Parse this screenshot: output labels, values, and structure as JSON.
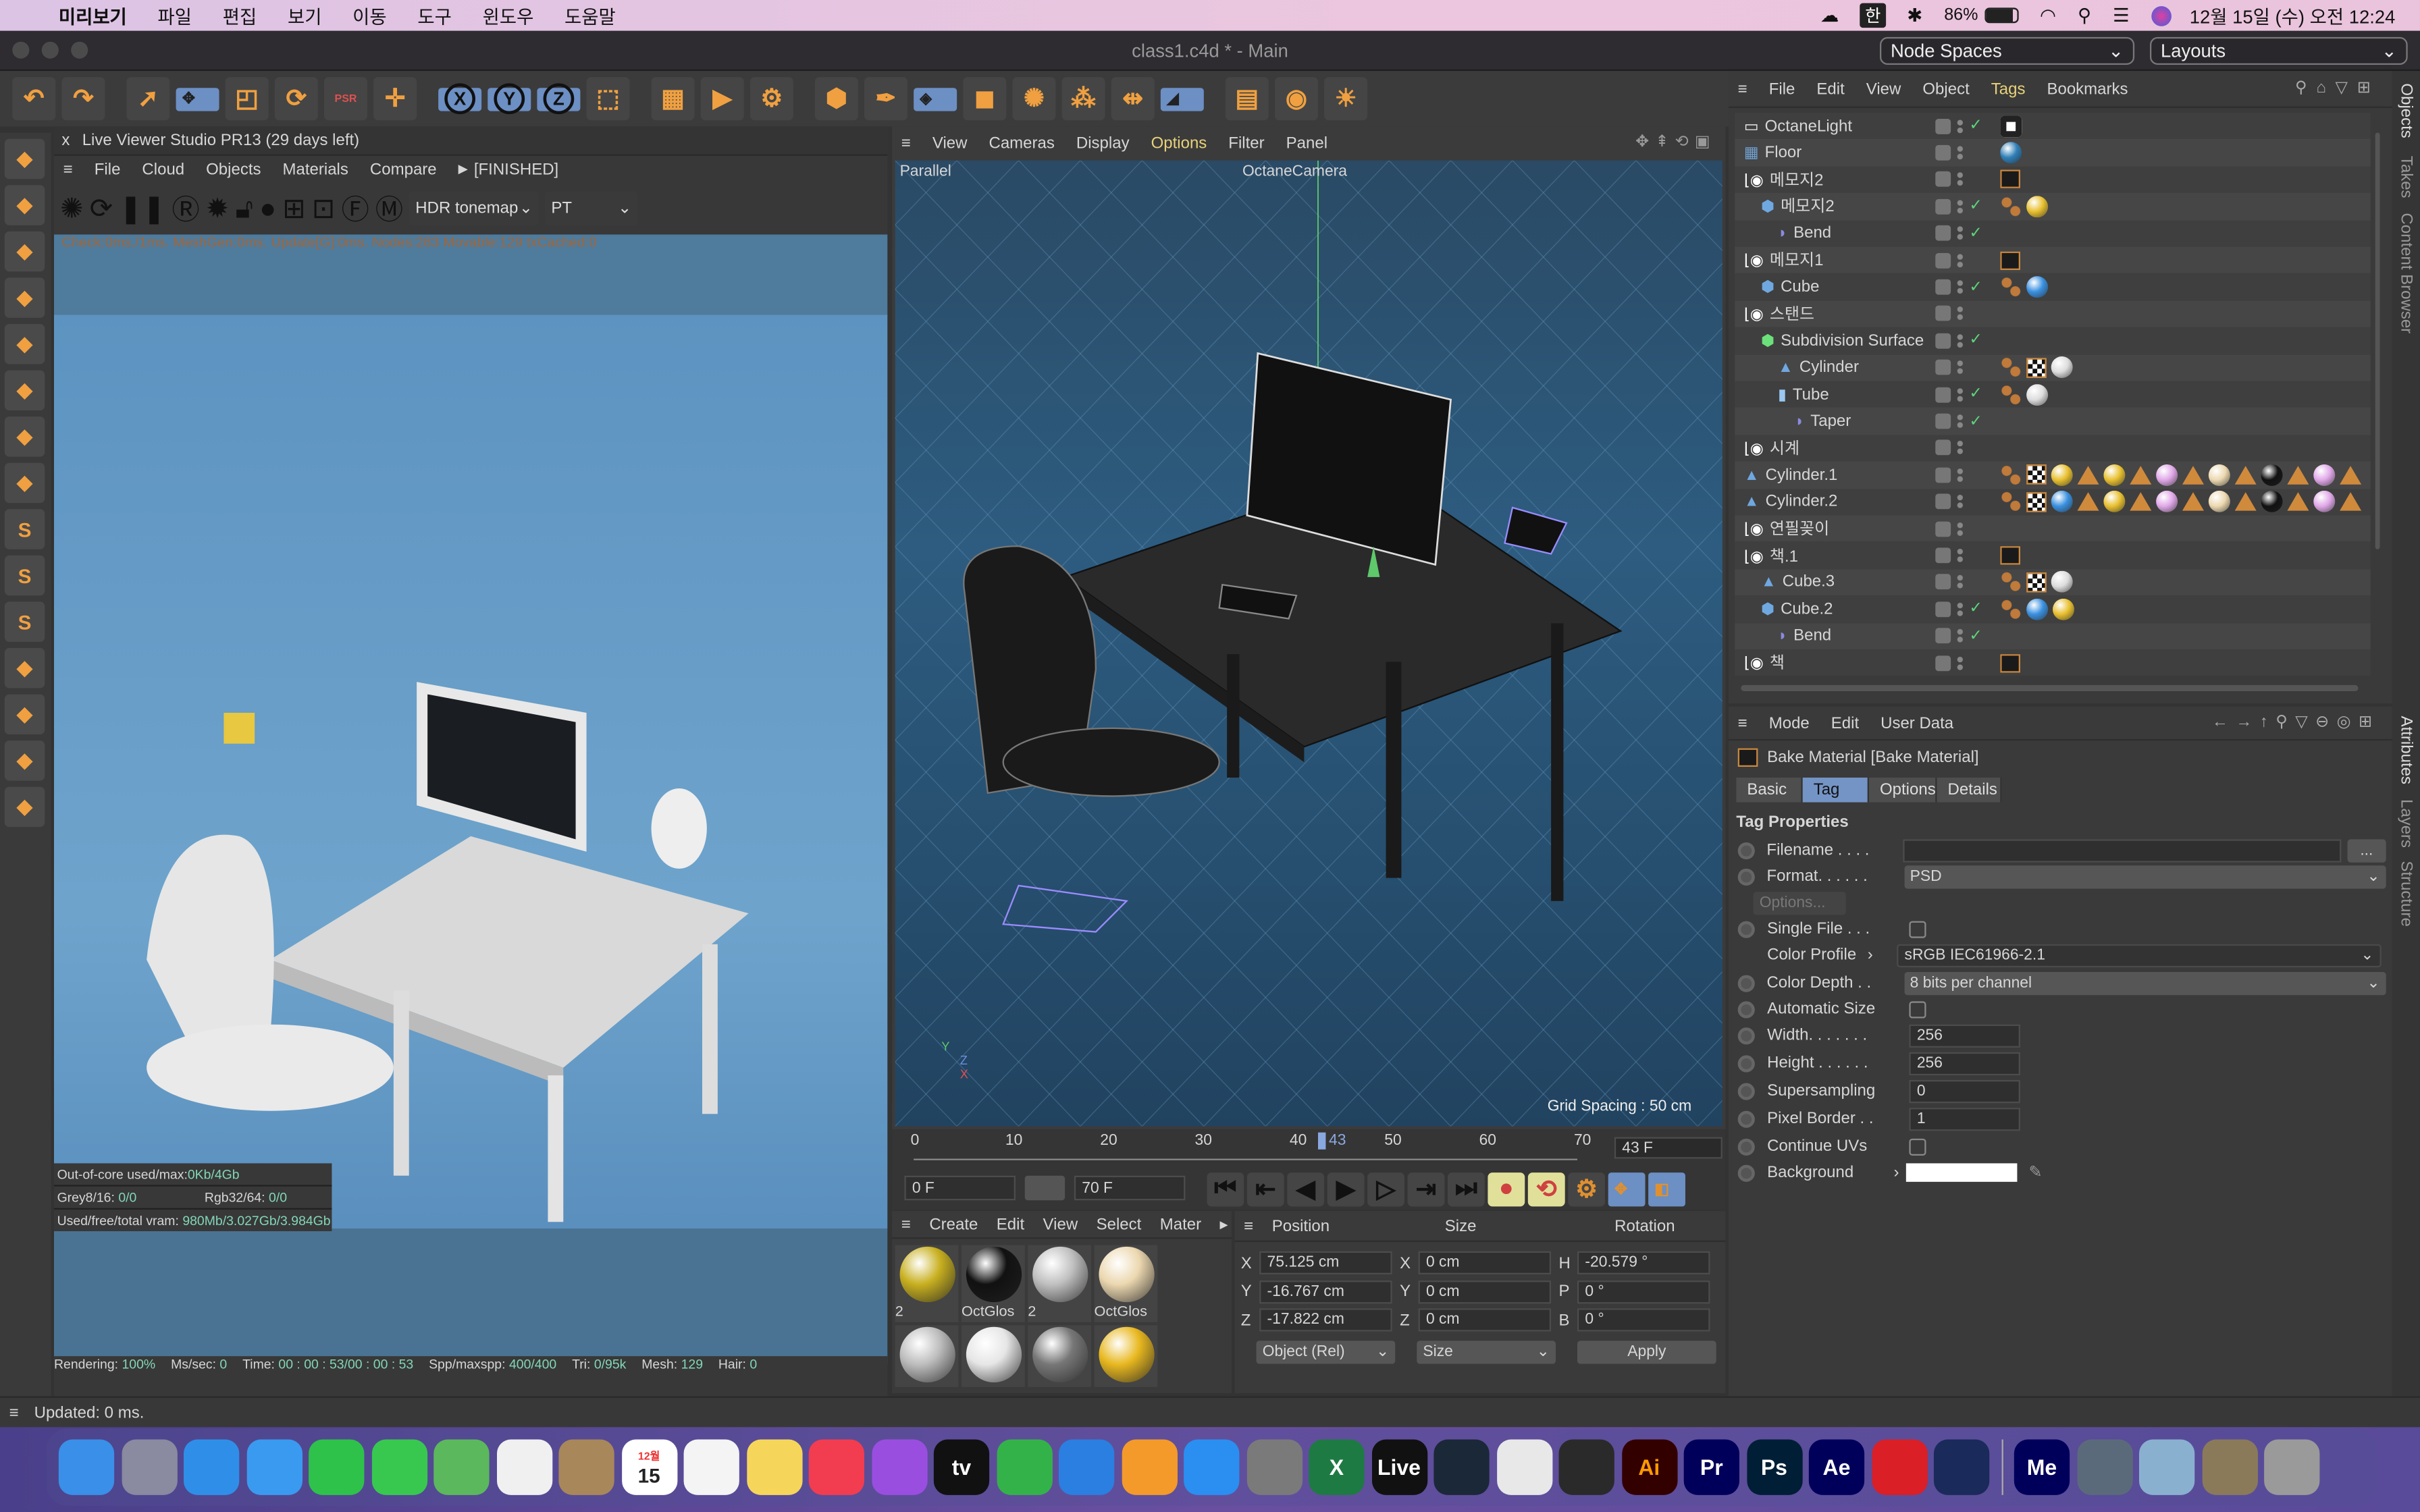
{
  "menubar": {
    "app": "미리보기",
    "items": [
      "파일",
      "편집",
      "보기",
      "이동",
      "도구",
      "윈도우",
      "도움말"
    ],
    "ime": "한",
    "battery": "86%",
    "clock": "12월 15일 (수) 오전 12:24"
  },
  "window": {
    "title": "class1.c4d * - Main",
    "node_spaces": "Node Spaces",
    "layouts": "Layouts"
  },
  "toolbar": {
    "icons": [
      "undo-icon",
      "redo-icon",
      "select-icon",
      "move-icon",
      "scale-icon",
      "rotate-icon",
      "psr-icon",
      "add-icon",
      "x-axis-icon",
      "y-axis-icon",
      "z-axis-icon",
      "coordinate-icon",
      "render-region-icon",
      "render-view-icon",
      "render-settings-icon",
      "cube-icon",
      "pen-icon",
      "subdivision-icon",
      "extrude-icon",
      "cloner-icon",
      "array-icon",
      "bend-icon",
      "deformer-icon",
      "floor-icon",
      "camera-icon",
      "light-icon"
    ],
    "axis_labels": [
      "X",
      "Y",
      "Z"
    ],
    "psr": "PSR"
  },
  "live_viewer": {
    "title": "Live Viewer Studio PR13 (29 days left)",
    "close": "x",
    "menu": [
      "File",
      "Cloud",
      "Objects",
      "Materials",
      "Compare"
    ],
    "state": "[FINISHED]",
    "tonemap": "HDR tonemap",
    "kernel": "PT",
    "info": "Check:0ms./1ms. MeshGen:0ms. Update[G]:0ms. Nodes:283 Movable:129 txCached:0",
    "stats": {
      "ooc_label": "Out-of-core used/max:",
      "ooc_value": "0Kb/4Gb",
      "grey_label": "Grey8/16:",
      "grey_value": "0/0",
      "rgb_label": "Rgb32/64:",
      "rgb_value": "0/0",
      "vram_label": "Used/free/total vram:",
      "vram_value": "980Mb/3.027Gb/3.984Gb"
    },
    "status": [
      {
        "label": "Rendering:",
        "value": "100%"
      },
      {
        "label": "Ms/sec:",
        "value": "0"
      },
      {
        "label": "Time:",
        "value": "00 : 00 : 53/00 : 00 : 53"
      },
      {
        "label": "Spp/maxspp:",
        "value": "400/400"
      },
      {
        "label": "Tri:",
        "value": "0/95k"
      },
      {
        "label": "Mesh:",
        "value": "129"
      },
      {
        "label": "Hair:",
        "value": "0"
      }
    ]
  },
  "viewport": {
    "menu": [
      "View",
      "Cameras",
      "Display",
      "Options",
      "Filter",
      "Panel"
    ],
    "active_menu": "Options",
    "projection": "Parallel",
    "camera": "OctaneCamera",
    "grid_spacing": "Grid Spacing : 50 cm",
    "axes": [
      "Y",
      "Z",
      "X"
    ]
  },
  "timeline": {
    "ticks": [
      "0",
      "10",
      "20",
      "30",
      "40",
      "50",
      "60",
      "70"
    ],
    "current": "43",
    "current_field": "43 F",
    "start": "0 F",
    "end": "70 F",
    "progress": 0.614
  },
  "material_manager": {
    "menu": [
      "Create",
      "Edit",
      "View",
      "Select",
      "Mater"
    ],
    "materials": [
      {
        "name": "2",
        "color": "#c8b020"
      },
      {
        "name": "OctGlos",
        "color": "#111111"
      },
      {
        "name": "2",
        "color": "#c0c0c0"
      },
      {
        "name": "OctGlos",
        "color": "#ecd8b0"
      },
      {
        "name": "",
        "color": "#bdbdbd"
      },
      {
        "name": "",
        "color": "#e6e6e6"
      },
      {
        "name": "",
        "color": "#777777"
      },
      {
        "name": "",
        "color": "#e8b820"
      }
    ]
  },
  "coords": {
    "headers": [
      "Position",
      "Size",
      "Rotation"
    ],
    "rows": [
      {
        "pl": "X",
        "pv": "75.125 cm",
        "sl": "X",
        "sv": "0 cm",
        "rl": "H",
        "rv": "-20.579 °"
      },
      {
        "pl": "Y",
        "pv": "-16.767 cm",
        "sl": "Y",
        "sv": "0 cm",
        "rl": "P",
        "rv": "0 °"
      },
      {
        "pl": "Z",
        "pv": "-17.822 cm",
        "sl": "Z",
        "sv": "0 cm",
        "rl": "B",
        "rv": "0 °"
      }
    ],
    "mode": "Object (Rel)",
    "size_mode": "Size",
    "apply": "Apply"
  },
  "object_manager": {
    "menu": [
      "File",
      "Edit",
      "View",
      "Object",
      "Tags",
      "Bookmarks"
    ],
    "active_menu": "Tags",
    "rows": [
      {
        "name": "OctaneLight",
        "depth": 0,
        "icon": "light",
        "check": true,
        "tags": [
          "light"
        ]
      },
      {
        "name": "Floor",
        "depth": 0,
        "icon": "floor",
        "check": false,
        "tags": [
          "#2f7fb8"
        ]
      },
      {
        "name": "메모지2",
        "depth": 0,
        "icon": "null",
        "check": false,
        "tags": [
          "bake"
        ]
      },
      {
        "name": "메모지2",
        "depth": 1,
        "icon": "cube",
        "check": true,
        "tags": [
          "dots",
          "#e8c030"
        ]
      },
      {
        "name": "Bend",
        "depth": 2,
        "icon": "deformer",
        "check": true,
        "tags": []
      },
      {
        "name": "메모지1",
        "depth": 0,
        "icon": "null",
        "check": false,
        "tags": [
          "bake"
        ]
      },
      {
        "name": "Cube",
        "depth": 1,
        "icon": "cube",
        "check": true,
        "tags": [
          "dots",
          "#3a90e0"
        ]
      },
      {
        "name": "스탠드",
        "depth": 0,
        "icon": "null",
        "check": false,
        "tags": []
      },
      {
        "name": "Subdivision Surface",
        "depth": 1,
        "icon": "subd",
        "check": true,
        "tags": []
      },
      {
        "name": "Cylinder",
        "depth": 2,
        "icon": "poly",
        "check": false,
        "tags": [
          "dots",
          "checker",
          "#dddddd"
        ]
      },
      {
        "name": "Tube",
        "depth": 2,
        "icon": "tube",
        "check": true,
        "tags": [
          "dots",
          "#dddddd"
        ]
      },
      {
        "name": "Taper",
        "depth": 3,
        "icon": "deformer",
        "check": true,
        "tags": []
      },
      {
        "name": "시계",
        "depth": 0,
        "icon": "null",
        "check": false,
        "tags": []
      },
      {
        "name": "Cylinder.1",
        "depth": 0,
        "icon": "poly",
        "check": false,
        "tags": [
          "dots",
          "checker",
          "#e8c030",
          "tri",
          "#e8c030",
          "tri",
          "#e0a8e8",
          "tri",
          "#ecd8b0",
          "tri",
          "#111111",
          "tri",
          "#e0a8e8",
          "tri"
        ]
      },
      {
        "name": "Cylinder.2",
        "depth": 0,
        "icon": "poly",
        "check": false,
        "tags": [
          "dots",
          "checker",
          "#3a90e0",
          "tri",
          "#e8c030",
          "tri",
          "#e0a8e8",
          "tri",
          "#ecd8b0",
          "tri",
          "#111111",
          "tri",
          "#e0a8e8",
          "tri"
        ]
      },
      {
        "name": "연필꽂이",
        "depth": 0,
        "icon": "null",
        "check": false,
        "tags": []
      },
      {
        "name": "책.1",
        "depth": 0,
        "icon": "null",
        "check": false,
        "tags": [
          "bake"
        ]
      },
      {
        "name": "Cube.3",
        "depth": 1,
        "icon": "poly",
        "check": false,
        "tags": [
          "dots",
          "checker",
          "#dddddd"
        ]
      },
      {
        "name": "Cube.2",
        "depth": 1,
        "icon": "cube",
        "check": true,
        "tags": [
          "dots",
          "#3a90e0",
          "#e8c030"
        ]
      },
      {
        "name": "Bend",
        "depth": 2,
        "icon": "deformer",
        "check": true,
        "tags": []
      },
      {
        "name": "책",
        "depth": 0,
        "icon": "null",
        "check": false,
        "tags": [
          "bake"
        ]
      }
    ]
  },
  "attributes": {
    "menu": [
      "Mode",
      "Edit",
      "User Data"
    ],
    "title": "Bake Material [Bake Material]",
    "tabs": [
      "Basic",
      "Tag",
      "Options",
      "Details"
    ],
    "active_tab": "Tag",
    "section": "Tag Properties",
    "options_button": "Options...",
    "browse": "...",
    "fields": [
      {
        "label": "Filename . . . .",
        "type": "text",
        "value": ""
      },
      {
        "label": "Format. . . . . .",
        "type": "select",
        "value": "PSD"
      },
      {
        "label": "Single File . . .",
        "type": "check",
        "value": false
      },
      {
        "label": "Color Profile",
        "type": "profile",
        "value": "sRGB IEC61966-2.1"
      },
      {
        "label": "Color Depth . .",
        "type": "select",
        "value": "8 bits per channel"
      },
      {
        "label": "Automatic Size",
        "type": "check",
        "value": false
      },
      {
        "label": "Width. . . . . . .",
        "type": "num",
        "value": "256"
      },
      {
        "label": "Height . . . . . .",
        "type": "num",
        "value": "256"
      },
      {
        "label": "Supersampling",
        "type": "num",
        "value": "0"
      },
      {
        "label": "Pixel Border . .",
        "type": "num",
        "value": "1"
      },
      {
        "label": "Continue UVs",
        "type": "check",
        "value": false
      },
      {
        "label": "Background",
        "type": "color",
        "value": "#ffffff"
      }
    ]
  },
  "side_tabs": {
    "top": [
      "Objects",
      "Takes",
      "Content Browser"
    ],
    "bottom": [
      "Attributes",
      "Layers",
      "Structure"
    ]
  },
  "statusbar": "Updated: 0 ms.",
  "dock": [
    {
      "n": "finder",
      "c": "#3a8fe8",
      "t": ""
    },
    {
      "n": "launchpad",
      "c": "#8a8aa0",
      "t": ""
    },
    {
      "n": "safari",
      "c": "#2f8fe8",
      "t": ""
    },
    {
      "n": "mail",
      "c": "#3a9af0",
      "t": ""
    },
    {
      "n": "facetime",
      "c": "#2ec24a",
      "t": ""
    },
    {
      "n": "messages",
      "c": "#38c850",
      "t": ""
    },
    {
      "n": "maps",
      "c": "#5cb85c",
      "t": ""
    },
    {
      "n": "photos",
      "c": "#f0f0f0",
      "t": ""
    },
    {
      "n": "contacts",
      "c": "#a8875a",
      "t": ""
    },
    {
      "n": "calendar",
      "c": "#ffffff",
      "t": "15"
    },
    {
      "n": "reminders",
      "c": "#f4f4f4",
      "t": ""
    },
    {
      "n": "notes",
      "c": "#f6d65a",
      "t": ""
    },
    {
      "n": "music",
      "c": "#f23c50",
      "t": ""
    },
    {
      "n": "podcasts",
      "c": "#9a4ee0",
      "t": ""
    },
    {
      "n": "tv",
      "c": "#111111",
      "t": "tv"
    },
    {
      "n": "numbers",
      "c": "#34b24a",
      "t": ""
    },
    {
      "n": "keynote",
      "c": "#2a7fe0",
      "t": ""
    },
    {
      "n": "pages",
      "c": "#f39a2a",
      "t": ""
    },
    {
      "n": "app-store",
      "c": "#2a8ff0",
      "t": ""
    },
    {
      "n": "system-preferences",
      "c": "#7a7a7a",
      "t": ""
    },
    {
      "n": "excel",
      "c": "#1e7a43",
      "t": "X"
    },
    {
      "n": "ableton-live",
      "c": "#111111",
      "t": "Live"
    },
    {
      "n": "steam",
      "c": "#1b2838",
      "t": ""
    },
    {
      "n": "chrome",
      "c": "#e8e8e8",
      "t": ""
    },
    {
      "n": "c4d-ring",
      "c": "#2a2a2a",
      "t": ""
    },
    {
      "n": "illustrator",
      "c": "#330000",
      "t": "Ai"
    },
    {
      "n": "premiere",
      "c": "#00005b",
      "t": "Pr"
    },
    {
      "n": "photoshop",
      "c": "#001e36",
      "t": "Ps"
    },
    {
      "n": "after-effects",
      "c": "#00005b",
      "t": "Ae"
    },
    {
      "n": "creative-cloud",
      "c": "#da1f26",
      "t": ""
    },
    {
      "n": "cinema4d",
      "c": "#1a2a5a",
      "t": ""
    },
    {
      "n": "media-encoder",
      "c": "#00005b",
      "t": "Me"
    },
    {
      "n": "quicktime",
      "c": "#5a6a7a",
      "t": ""
    },
    {
      "n": "preview",
      "c": "#8ab0d0",
      "t": ""
    },
    {
      "n": "photo",
      "c": "#8a7a5a",
      "t": ""
    },
    {
      "n": "trash",
      "c": "#9a9a9a",
      "t": ""
    }
  ],
  "calendar_month": "12월"
}
